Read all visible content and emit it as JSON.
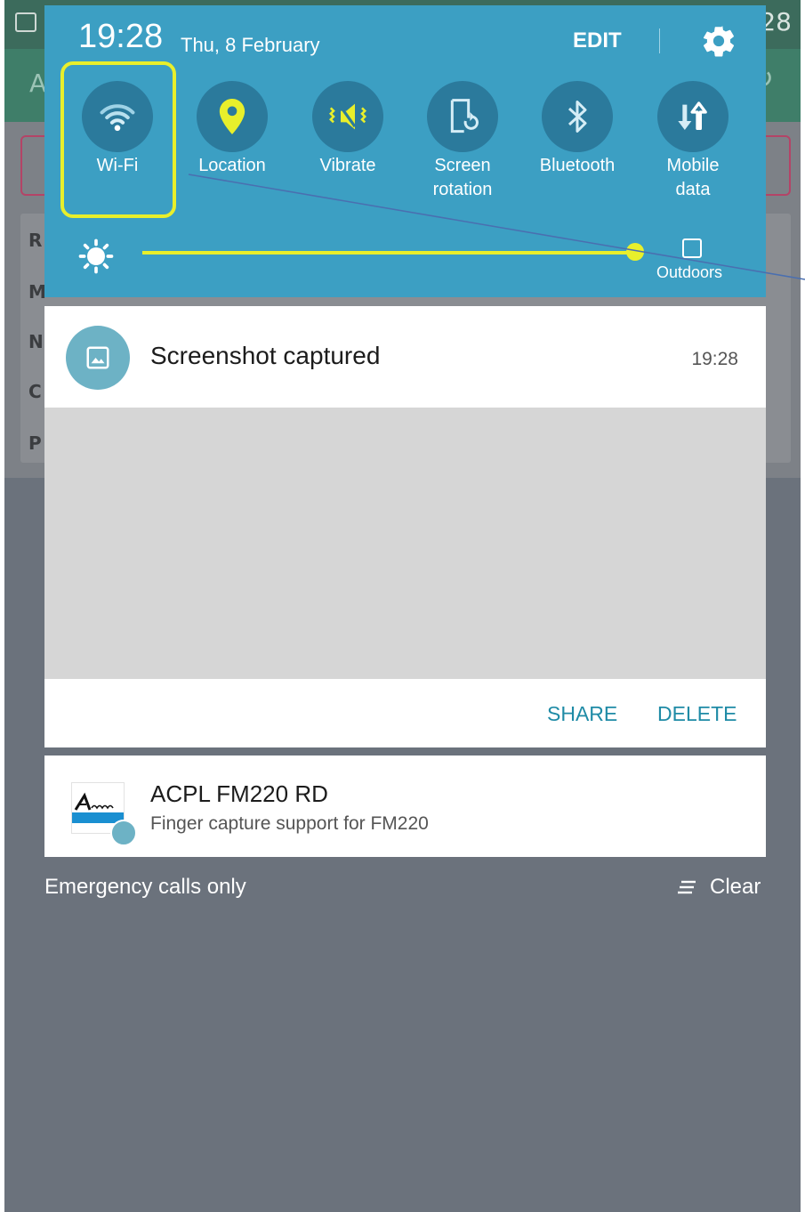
{
  "background_app": {
    "clock": "28",
    "partial_letters": [
      "R",
      "M",
      "N",
      "C",
      "P"
    ],
    "appbar_letter": "A"
  },
  "quick_panel": {
    "time": "19:28",
    "date": "Thu, 8 February",
    "edit_label": "EDIT",
    "tiles": [
      {
        "label": "Wi-Fi",
        "icon": "wifi-icon"
      },
      {
        "label": "Location",
        "icon": "location-icon"
      },
      {
        "label": "Vibrate",
        "icon": "vibrate-icon"
      },
      {
        "label": "Screen\nrotation",
        "label_line1": "Screen",
        "label_line2": "rotation",
        "icon": "screen-rotation-icon"
      },
      {
        "label": "Bluetooth",
        "icon": "bluetooth-icon"
      },
      {
        "label": "Mobile\ndata",
        "label_line1": "Mobile",
        "label_line2": "data",
        "icon": "mobile-data-icon"
      }
    ],
    "brightness_level": 0.95,
    "outdoors_label": "Outdoors"
  },
  "notifications": [
    {
      "title": "Screenshot captured",
      "time": "19:28",
      "actions": {
        "share": "SHARE",
        "delete": "DELETE"
      }
    },
    {
      "title": "ACPL FM220 RD",
      "subtitle": "Finger capture support for FM220",
      "logo_text": "Access"
    }
  ],
  "footer": {
    "emergency": "Emergency calls only",
    "clear": "Clear"
  },
  "colors": {
    "panel": "#3c9fc3",
    "highlight": "#e8ef2b",
    "accent": "#1f8ba6"
  }
}
